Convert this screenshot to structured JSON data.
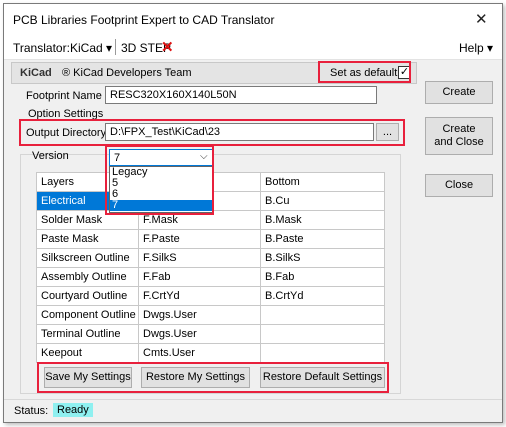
{
  "window": {
    "title": "PCB Libraries Footprint Expert to CAD Translator"
  },
  "menubar": {
    "translator_label": "Translator:",
    "kicad_menu": "KiCad",
    "step_menu": "3D STEP",
    "help_menu": "Help"
  },
  "header": {
    "logo_text": "KiCad",
    "team_text": "® KiCad Developers Team",
    "set_default_label": "Set as default",
    "set_default_checked": "✓"
  },
  "form": {
    "footprint_name_label": "Footprint Name",
    "footprint_name_value": "RESC320X160X140L50N",
    "option_settings_label": "Option Settings",
    "output_directory_label": "Output Directory",
    "output_directory_value": "D:\\FPX_Test\\KiCad\\23",
    "browse_label": "...",
    "version_label": "Version",
    "version_value": "7"
  },
  "version_options": [
    "Legacy",
    "5",
    "6",
    "7"
  ],
  "actions": {
    "create_label": "Create",
    "create_close_line1": "Create",
    "create_close_line2": "and Close",
    "close_label": "Close"
  },
  "layers_table": {
    "headers": [
      "Layers",
      "",
      "Bottom"
    ],
    "rows": [
      [
        "Electrical",
        "",
        "B.Cu"
      ],
      [
        "Solder Mask",
        "F.Mask",
        "B.Mask"
      ],
      [
        "Paste Mask",
        "F.Paste",
        "B.Paste"
      ],
      [
        "Silkscreen Outline",
        "F.SilkS",
        "B.SilkS"
      ],
      [
        "Assembly Outline",
        "F.Fab",
        "B.Fab"
      ],
      [
        "Courtyard Outline",
        "F.CrtYd",
        "B.CrtYd"
      ],
      [
        "Component Outline",
        "Dwgs.User",
        ""
      ],
      [
        "Terminal Outline",
        "Dwgs.User",
        ""
      ],
      [
        "Keepout",
        "Cmts.User",
        ""
      ]
    ]
  },
  "settings_buttons": {
    "save": "Save My Settings",
    "restore": "Restore My Settings",
    "restore_default": "Restore Default Settings"
  },
  "status": {
    "label": "Status:",
    "value": "Ready"
  },
  "colors": {
    "highlight_box": "#e8203c",
    "selection": "#0078d7",
    "status_ready_bg": "#8ff0f0"
  }
}
